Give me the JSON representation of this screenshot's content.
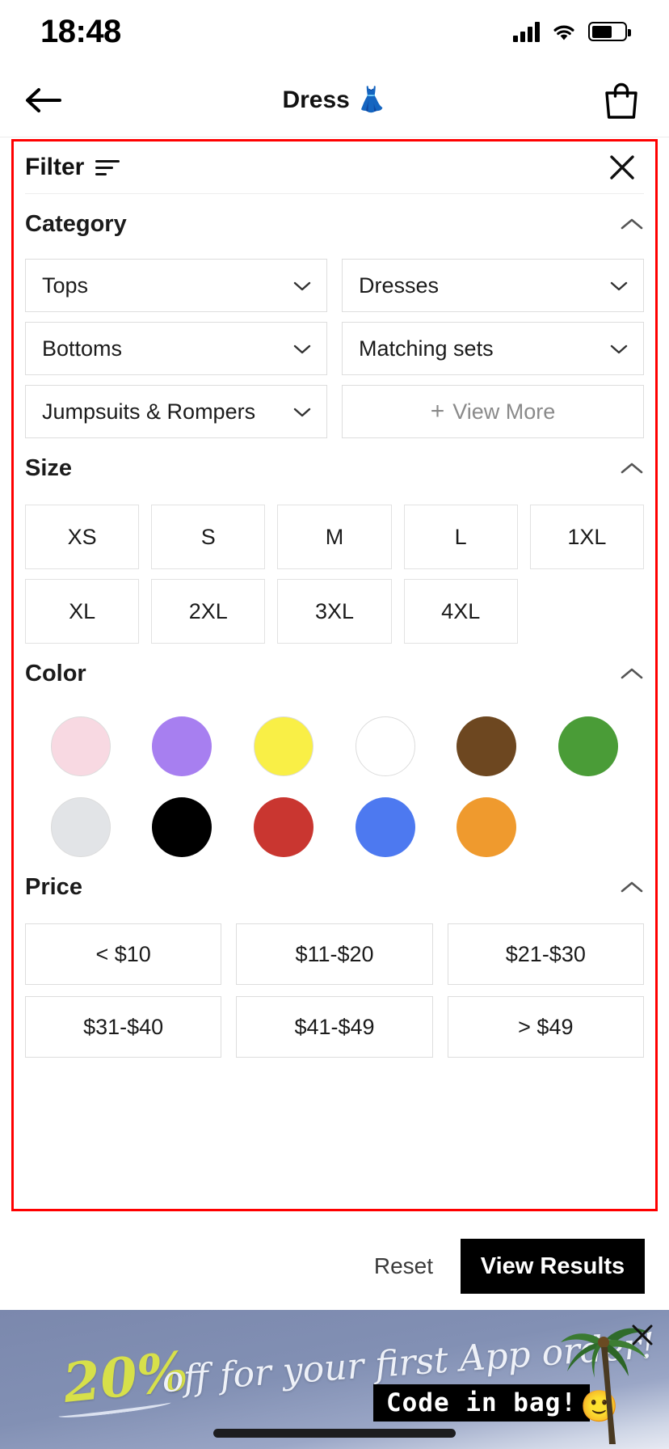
{
  "status_bar": {
    "time": "18:48",
    "signal_icon": "cellular-signal-icon",
    "wifi_icon": "wifi-icon",
    "battery_icon": "battery-icon"
  },
  "nav": {
    "back_icon": "back-arrow-icon",
    "title": "Dress 👗",
    "bag_icon": "shopping-bag-icon"
  },
  "filter": {
    "title": "Filter",
    "filter_icon": "filter-lines-icon",
    "close_icon": "close-icon",
    "sections": {
      "category": {
        "title": "Category",
        "collapse_icon": "chevron-up-icon",
        "items": [
          {
            "label": "Tops"
          },
          {
            "label": "Dresses"
          },
          {
            "label": "Bottoms"
          },
          {
            "label": "Matching sets"
          },
          {
            "label": "Jumpsuits & Rompers"
          }
        ],
        "view_more": {
          "plus": "+",
          "label": "View More"
        }
      },
      "size": {
        "title": "Size",
        "collapse_icon": "chevron-up-icon",
        "options": [
          "XS",
          "S",
          "M",
          "L",
          "1XL",
          "XL",
          "2XL",
          "3XL",
          "4XL"
        ]
      },
      "color": {
        "title": "Color",
        "collapse_icon": "chevron-up-icon",
        "swatches": [
          {
            "name": "pink",
            "hex": "#f8d9e2"
          },
          {
            "name": "purple",
            "hex": "#a77ff0"
          },
          {
            "name": "yellow",
            "hex": "#f9ef46"
          },
          {
            "name": "white",
            "hex": "#ffffff"
          },
          {
            "name": "brown",
            "hex": "#6d4720"
          },
          {
            "name": "green",
            "hex": "#4a9c37"
          },
          {
            "name": "silver",
            "hex": "#e2e4e7"
          },
          {
            "name": "black",
            "hex": "#000000"
          },
          {
            "name": "red",
            "hex": "#c93630"
          },
          {
            "name": "blue",
            "hex": "#4d79f0"
          },
          {
            "name": "orange",
            "hex": "#ef9a2e"
          }
        ]
      },
      "price": {
        "title": "Price",
        "collapse_icon": "chevron-up-icon",
        "ranges": [
          "< $10",
          "$11-$20",
          "$21-$30",
          "$31-$40",
          "$41-$49",
          "> $49"
        ]
      }
    }
  },
  "footer": {
    "reset_label": "Reset",
    "view_results_label": "View Results",
    "view_results_bg": "#000000"
  },
  "banner": {
    "percent": "20%",
    "message": "off for your first App order!",
    "code_badge": "Code in bag!",
    "emoji": "🙂",
    "close_icon": "close-icon",
    "accent_hex": "#d7e04a"
  }
}
